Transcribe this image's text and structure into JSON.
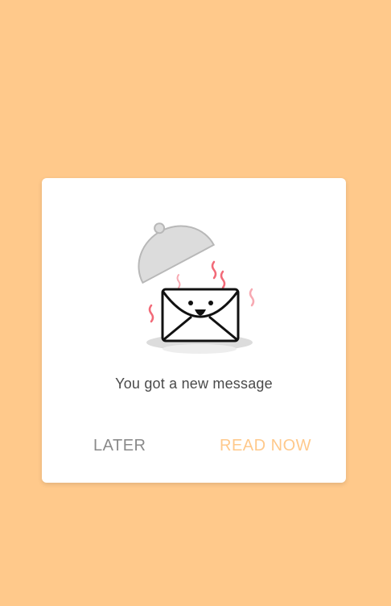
{
  "dialog": {
    "message": "You got a new message",
    "later_label": "LATER",
    "read_now_label": "READ NOW",
    "illustration_icon": "envelope-under-cloche-icon"
  },
  "colors": {
    "background": "#FFC98B",
    "card": "#FFFFFF",
    "message_text": "#4a4a4a",
    "secondary_button": "#8a8a8a",
    "primary_button": "#FFC98B",
    "steam": "#F26A78"
  }
}
